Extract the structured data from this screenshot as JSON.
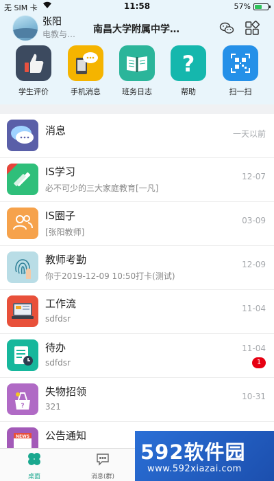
{
  "status_bar": {
    "carrier": "无 SIM 卡",
    "time": "11:58",
    "battery": "57%",
    "battery_level": 0.57
  },
  "header": {
    "user_name": "张阳",
    "user_dept": "电教与…",
    "school": "南昌大学附属中学…"
  },
  "quick_actions": [
    {
      "label": "学生评价",
      "icon": "thumbs-up-icon",
      "color": "#3c4a5f"
    },
    {
      "label": "手机消息",
      "icon": "phone-chat-icon",
      "color": "#f5b400"
    },
    {
      "label": "班务日志",
      "icon": "book-icon",
      "color": "#2bb59a"
    },
    {
      "label": "帮助",
      "icon": "help-icon",
      "color": "#15b7ad"
    },
    {
      "label": "扫一扫",
      "icon": "qr-scan-icon",
      "color": "#2590e8"
    }
  ],
  "list": [
    {
      "title": "消息",
      "subtitle": "",
      "date": "一天以前",
      "icon": "chat-bubble-icon"
    },
    {
      "title": "IS学习",
      "subtitle": "必不可少的三大家庭教育[一凡]",
      "date": "12-07",
      "icon": "pencil-ruler-icon"
    },
    {
      "title": "IS圈子",
      "subtitle": "[张阳教师]",
      "date": "03-09",
      "icon": "people-icon"
    },
    {
      "title": "教师考勤",
      "subtitle": "你于2019-12-09 10:50打卡(测试)",
      "date": "12-09",
      "icon": "fingerprint-icon"
    },
    {
      "title": "工作流",
      "subtitle": "sdfdsr",
      "date": "11-04",
      "icon": "workflow-icon"
    },
    {
      "title": "待办",
      "subtitle": "sdfdsr",
      "date": "11-04",
      "badge": "1",
      "icon": "todo-icon"
    },
    {
      "title": "失物招领",
      "subtitle": "321",
      "date": "10-31",
      "icon": "lost-found-icon"
    },
    {
      "title": "公告通知",
      "subtitle": "",
      "date": "",
      "icon": "news-icon"
    }
  ],
  "tabbar": [
    {
      "label": "桌面",
      "icon": "desktop-icon",
      "active": true
    },
    {
      "label": "消息(群)",
      "icon": "message-icon",
      "active": false
    }
  ],
  "watermark": {
    "logo": "592软件园",
    "url": "www.592xiazai.com"
  }
}
